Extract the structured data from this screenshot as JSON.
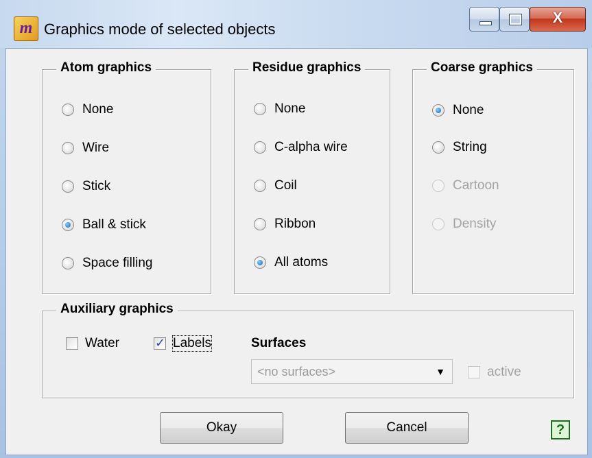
{
  "window": {
    "title": "Graphics mode of selected objects",
    "app_icon_glyph": "m",
    "minimize_glyph": "",
    "maximize_glyph": "",
    "close_glyph": "X"
  },
  "atom_graphics": {
    "legend": "Atom graphics",
    "options": [
      {
        "label": "None",
        "checked": false
      },
      {
        "label": "Wire",
        "checked": false
      },
      {
        "label": "Stick",
        "checked": false
      },
      {
        "label": "Ball & stick",
        "checked": true
      },
      {
        "label": "Space filling",
        "checked": false
      }
    ]
  },
  "residue_graphics": {
    "legend": "Residue graphics",
    "options": [
      {
        "label": "None",
        "checked": false
      },
      {
        "label": "C-alpha wire",
        "checked": false
      },
      {
        "label": "Coil",
        "checked": false
      },
      {
        "label": "Ribbon",
        "checked": false
      },
      {
        "label": "All atoms",
        "checked": true
      }
    ]
  },
  "coarse_graphics": {
    "legend": "Coarse graphics",
    "options": [
      {
        "label": "None",
        "checked": true,
        "enabled": true
      },
      {
        "label": "String",
        "checked": false,
        "enabled": true
      },
      {
        "label": "Cartoon",
        "checked": false,
        "enabled": false
      },
      {
        "label": "Density",
        "checked": false,
        "enabled": false
      }
    ]
  },
  "auxiliary_graphics": {
    "legend": "Auxiliary graphics",
    "water_label": "Water",
    "water_checked": false,
    "labels_label": "Labels",
    "labels_checked": true,
    "surfaces_label": "Surfaces",
    "surfaces_value": "<no surfaces>",
    "active_label": "active",
    "active_checked": false
  },
  "buttons": {
    "okay": "Okay",
    "cancel": "Cancel",
    "help": "?"
  },
  "colors": {
    "title_bar": "#c7d9ef",
    "dialog_background": "#f0f0f0",
    "close_button": "#c2371d",
    "help_green": "#1f6b1f"
  }
}
